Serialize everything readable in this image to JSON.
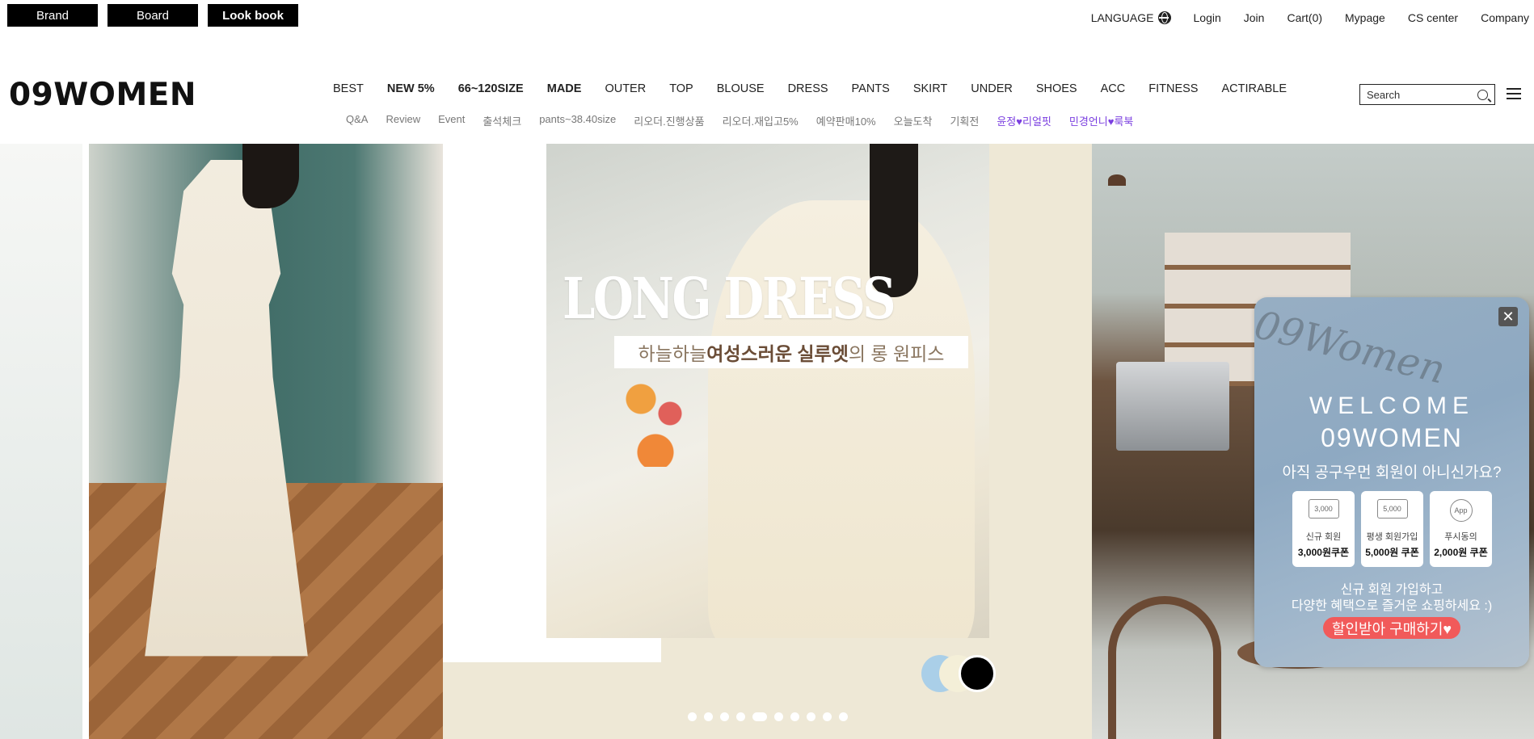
{
  "utility": {
    "left_buttons": [
      "Brand",
      "Board",
      "Look book"
    ],
    "language": "LANGUAGE",
    "right_links": [
      "Login",
      "Join",
      "Cart(0)",
      "Mypage",
      "CS center",
      "Company"
    ]
  },
  "header": {
    "logo": "09WOMEN",
    "nav_main": [
      "BEST",
      "NEW 5%",
      "66~120SIZE",
      "MADE",
      "OUTER",
      "TOP",
      "BLOUSE",
      "DRESS",
      "PANTS",
      "SKIRT",
      "UNDER",
      "SHOES",
      "ACC",
      "FITNESS",
      "ACTIRABLE"
    ],
    "nav_sub": [
      "Q&A",
      "Review",
      "Event",
      "출석체크",
      "pants~38.40size",
      "리오더.진행상품",
      "리오더.재입고5%",
      "예약판매10%",
      "오늘도착",
      "기획전",
      "윤정♥리얼핏",
      "민경언니♥룩북"
    ],
    "search_placeholder": "Search"
  },
  "hero": {
    "title": "LONG DRESS",
    "subtitle_pre": "하늘하늘 ",
    "subtitle_bold": "여성스러운 실루엣",
    "subtitle_post": "의 롱 원피스",
    "slide_count": 10,
    "active_slide": 5
  },
  "popup": {
    "script_text": "09Women",
    "close": "✕",
    "welcome": "WELCOME",
    "brand": "09WOMEN",
    "question": "아직 공구우먼 회원이 아니신가요?",
    "coupons": [
      {
        "icon": "3,000",
        "line1": "신규 회원",
        "line2": "3,000원쿠폰"
      },
      {
        "icon": "5,000",
        "line1": "평생 회원가입",
        "line2": "5,000원 쿠폰"
      },
      {
        "icon": "App",
        "line1": "푸시동의",
        "line2": "2,000원 쿠폰"
      }
    ],
    "desc1": "신규 회원 가입하고",
    "desc2": "다양한 혜택으로 즐거운 쇼핑하세요 :)",
    "cta": "할인받아 구매하기♥"
  },
  "colors": {
    "accent_purple": "#7b3fe0",
    "cta_red": "#f15a5a",
    "black": "#000000"
  }
}
